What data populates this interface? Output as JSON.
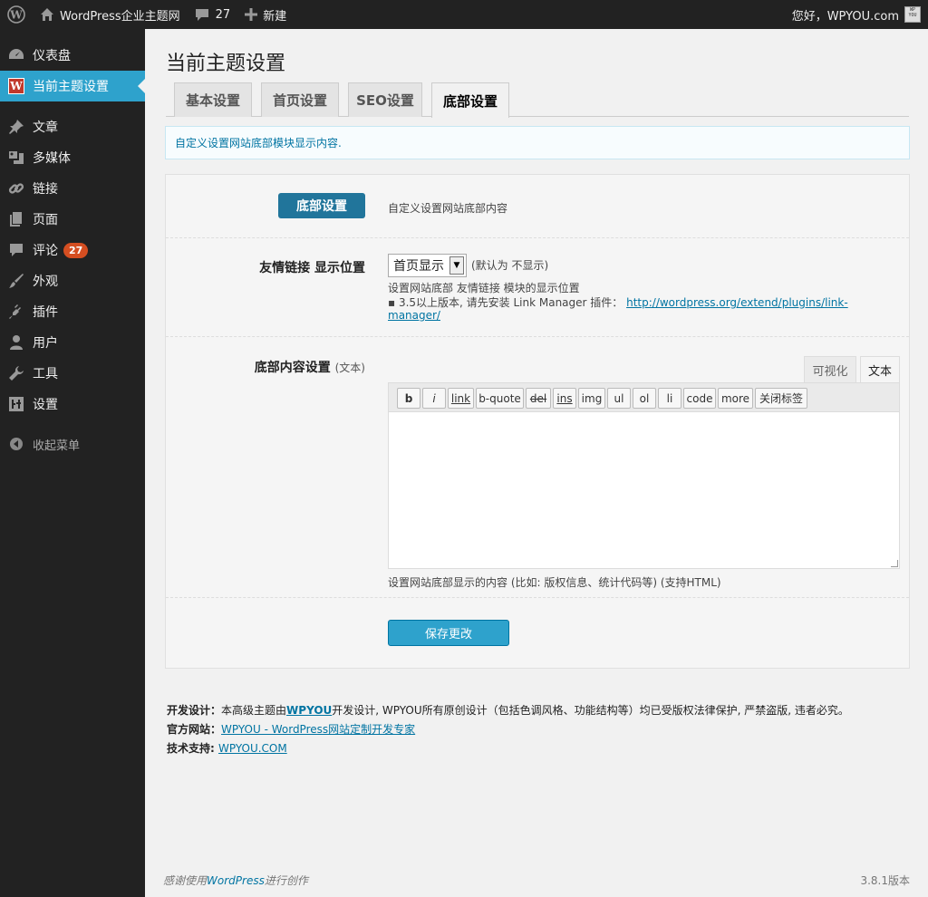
{
  "adminbar": {
    "site_name": "WordPress企业主题网",
    "comments_count": "27",
    "new_label": "新建",
    "greeting": "您好，WPYOU.com",
    "avatar_text": "WP YOU"
  },
  "sidebar": {
    "items": [
      {
        "label": "仪表盘",
        "icon": "dashboard-icon"
      },
      {
        "label": "当前主题设置",
        "icon": "w-logo-icon"
      },
      {
        "label": "文章",
        "icon": "pin-icon"
      },
      {
        "label": "多媒体",
        "icon": "media-icon"
      },
      {
        "label": "链接",
        "icon": "link-icon"
      },
      {
        "label": "页面",
        "icon": "pages-icon"
      },
      {
        "label": "评论",
        "icon": "comment-icon",
        "badge": "27"
      },
      {
        "label": "外观",
        "icon": "brush-icon"
      },
      {
        "label": "插件",
        "icon": "plugin-icon"
      },
      {
        "label": "用户",
        "icon": "user-icon"
      },
      {
        "label": "工具",
        "icon": "wrench-icon"
      },
      {
        "label": "设置",
        "icon": "settings-icon"
      }
    ],
    "collapse_label": "收起菜单"
  },
  "page": {
    "title": "当前主题设置",
    "tabs": [
      "基本设置",
      "首页设置",
      "SEO设置",
      "底部设置"
    ],
    "active_tab": "底部设置",
    "notice": "自定义设置网站底部模块显示内容."
  },
  "section": {
    "button_label": "底部设置",
    "description": "自定义设置网站底部内容"
  },
  "links_field": {
    "label": "友情链接 显示位置",
    "selected": "首页显示",
    "default_hint": "(默认为 不显示)",
    "desc_line1": "设置网站底部 友情链接 模块的显示位置",
    "desc_line2": "▪ 3.5以上版本, 请先安装 Link Manager 插件：",
    "link_url_1": "http://wordpress.org/extend/plugins/link-",
    "link_url_2": "manager/"
  },
  "content_field": {
    "label": "底部内容设置",
    "label_sub": "(文本)",
    "tab_visual": "可视化",
    "tab_text": "文本",
    "quicktags": [
      "b",
      "i",
      "link",
      "b-quote",
      "del",
      "ins",
      "img",
      "ul",
      "ol",
      "li",
      "code",
      "more",
      "关闭标签"
    ],
    "editor_value": "",
    "desc": "设置网站底部显示的内容 (比如: 版权信息、统计代码等) (支持HTML)"
  },
  "save_label": "保存更改",
  "credits": {
    "design_label": "开发设计：",
    "design_pre": "本高级主题由",
    "design_brand": "WPYOU",
    "design_post": "开发设计, WPYOU所有原创设计（包括色调风格、功能结构等）均已受版权法律保护, 严禁盗版, 违者必究。",
    "site_label": "官方网站：",
    "site_link": "WPYOU - WordPress网站定制开发专家",
    "support_label": "技术支持: ",
    "support_link": "WPYOU.COM"
  },
  "footer": {
    "thanks_pre": "感谢使用",
    "thanks_link": "WordPress",
    "thanks_post": "进行创作",
    "version": "3.8.1版本"
  },
  "colors": {
    "adminbar_bg": "#222222",
    "sidebar_active": "#2ea2cc",
    "primary_button": "#2ea2cc",
    "section_button": "#21759b",
    "badge": "#d54e21"
  }
}
